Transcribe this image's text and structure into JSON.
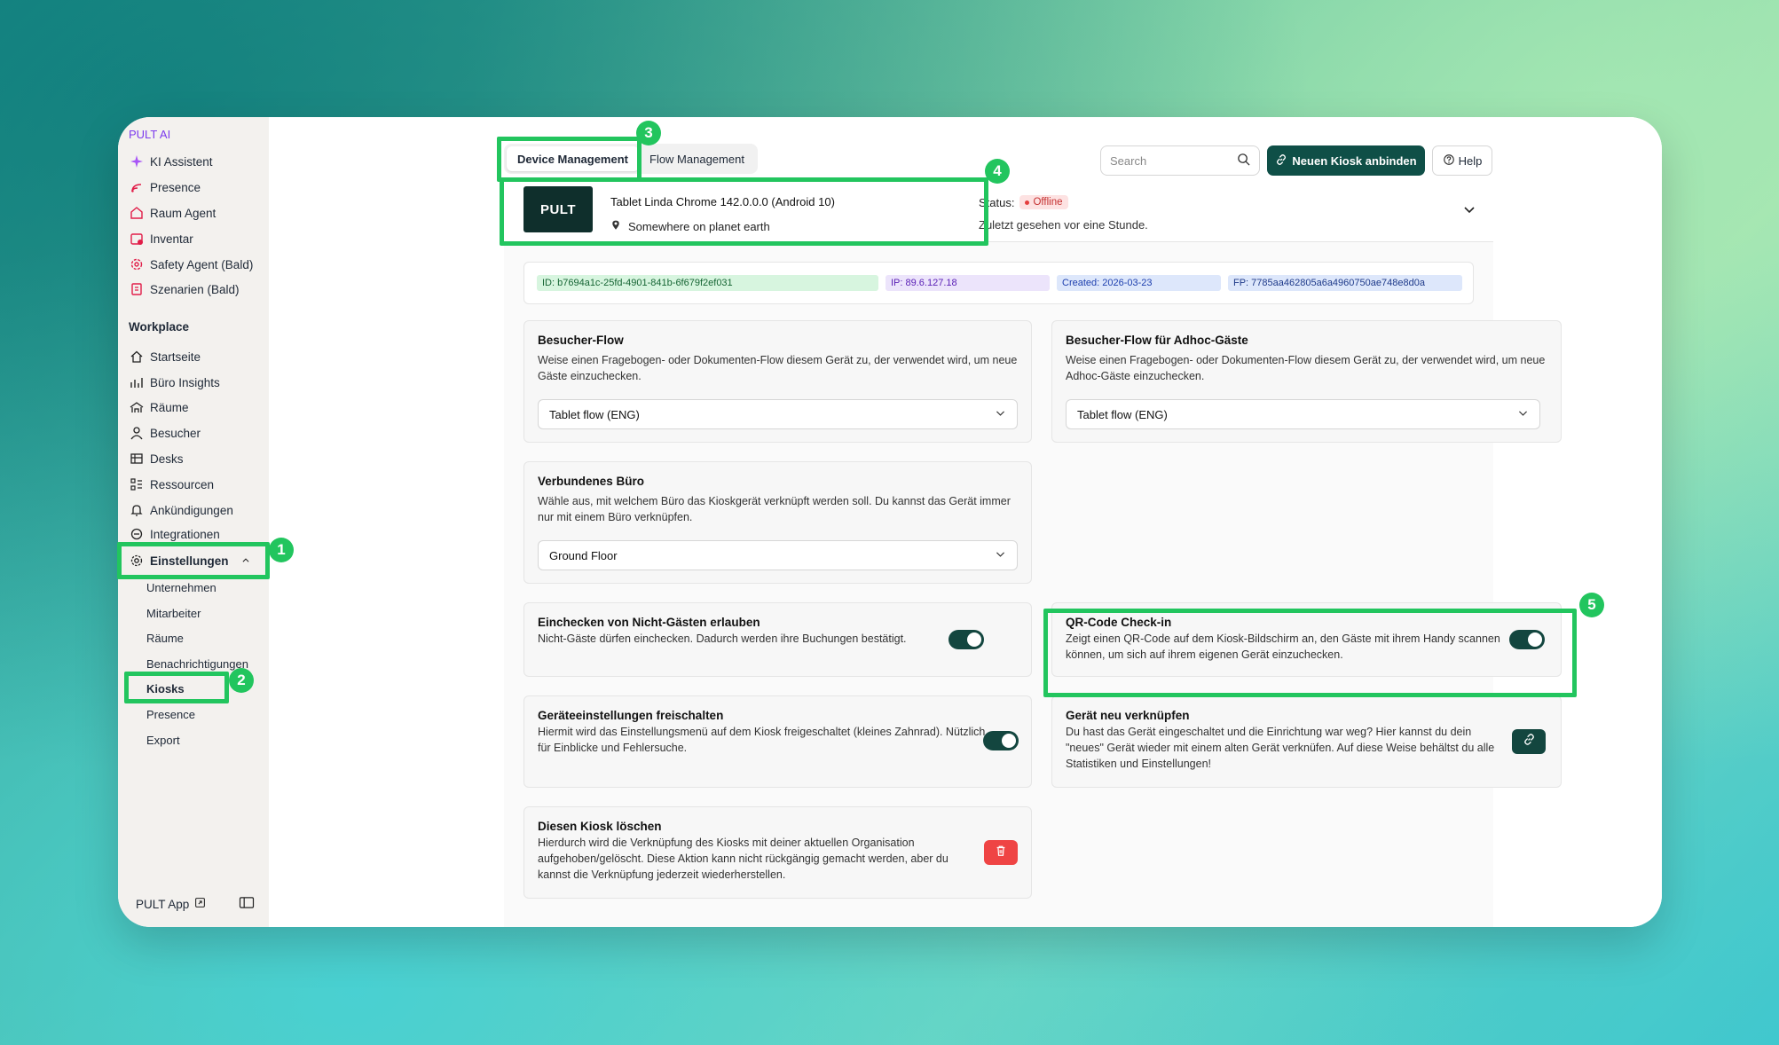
{
  "sidebar": {
    "brand": "PULT AI",
    "ai_items": [
      {
        "label": "KI Assistent",
        "icon": "sparkle-icon"
      },
      {
        "label": "Presence",
        "icon": "presence-icon"
      },
      {
        "label": "Raum Agent",
        "icon": "room-agent-icon"
      },
      {
        "label": "Inventar",
        "icon": "inventory-icon"
      },
      {
        "label": "Safety Agent (Bald)",
        "icon": "safety-icon"
      },
      {
        "label": "Szenarien (Bald)",
        "icon": "scenario-icon"
      }
    ],
    "section_label": "Workplace",
    "workplace_items": [
      {
        "label": "Startseite",
        "icon": "home-icon"
      },
      {
        "label": "Büro Insights",
        "icon": "chart-icon"
      },
      {
        "label": "Räume",
        "icon": "rooms-icon"
      },
      {
        "label": "Besucher",
        "icon": "user-icon"
      },
      {
        "label": "Desks",
        "icon": "desk-icon"
      },
      {
        "label": "Ressourcen",
        "icon": "resources-icon"
      },
      {
        "label": "Ankündigungen",
        "icon": "bell-icon"
      },
      {
        "label": "Integrationen",
        "icon": "integration-icon"
      }
    ],
    "settings_label": "Einstellungen",
    "settings_items": [
      {
        "label": "Unternehmen"
      },
      {
        "label": "Mitarbeiter"
      },
      {
        "label": "Räume"
      },
      {
        "label": "Benachrichtigungen"
      },
      {
        "label": "Kiosks"
      },
      {
        "label": "Presence"
      },
      {
        "label": "Export"
      }
    ],
    "footer_app": "PULT App"
  },
  "header": {
    "tabs": [
      {
        "label": "Device Management",
        "active": true
      },
      {
        "label": "Flow Management",
        "active": false
      }
    ],
    "search_placeholder": "Search",
    "connect_button": "Neuen Kiosk anbinden",
    "help_button": "Help"
  },
  "device": {
    "logo_text": "PULT",
    "name": "Tablet Linda Chrome 142.0.0.0 (Android 10)",
    "location": "Somewhere on planet earth",
    "status_label": "Status:",
    "status_value": "Offline",
    "last_seen": "Zuletzt gesehen vor eine Stunde."
  },
  "ids": {
    "id": "ID: b7694a1c-25fd-4901-841b-6f679f2ef031",
    "ip": "IP: 89.6.127.18",
    "created": "Created: 2026-03-23",
    "fp": "FP: 7785aa462805a6a4960750ae748e8d0a"
  },
  "cards": {
    "visitor_flow": {
      "title": "Besucher-Flow",
      "desc": "Weise einen Fragebogen- oder Dokumenten-Flow diesem Gerät zu, der verwendet wird, um neue Gäste einzuchecken.",
      "value": "Tablet flow (ENG)"
    },
    "adhoc_flow": {
      "title": "Besucher-Flow für Adhoc-Gäste",
      "desc": "Weise einen Fragebogen- oder Dokumenten-Flow diesem Gerät zu, der verwendet wird, um neue Adhoc-Gäste einzuchecken.",
      "value": "Tablet flow (ENG)"
    },
    "office": {
      "title": "Verbundenes Büro",
      "desc": "Wähle aus, mit welchem Büro das Kioskgerät verknüpft werden soll. Du kannst das Gerät immer nur mit einem Büro verknüpfen.",
      "value": "Ground Floor"
    },
    "non_guest": {
      "title": "Einchecken von Nicht-Gästen erlauben",
      "desc": "Nicht-Gäste dürfen einchecken. Dadurch werden ihre Buchungen bestätigt."
    },
    "qr": {
      "title": "QR-Code Check-in",
      "desc": "Zeigt einen QR-Code auf dem Kiosk-Bildschirm an, den Gäste mit ihrem Handy scannen können, um sich auf ihrem eigenen Gerät einzuchecken."
    },
    "device_settings": {
      "title": "Geräteeinstellungen freischalten",
      "desc": "Hiermit wird das Einstellungsmenü auf dem Kiosk freigeschaltet (kleines Zahnrad). Nützlich für Einblicke und Fehlersuche."
    },
    "relink": {
      "title": "Gerät neu verknüpfen",
      "desc": "Du hast das Gerät eingeschaltet und die Einrichtung war weg? Hier kannst du dein \"neues\" Gerät wieder mit einem alten Gerät verknüfen. Auf diese Weise behältst du alle Statistiken und Einstellungen!"
    },
    "delete": {
      "title": "Diesen Kiosk löschen",
      "desc": "Hierdurch wird die Verknüpfung des Kiosks mit deiner aktuellen Organisation aufgehoben/gelöscht. Diese Aktion kann nicht rückgängig gemacht werden, aber du kannst die Verknüpfung jederzeit wiederherstellen."
    }
  },
  "annotations": [
    "1",
    "2",
    "3",
    "4",
    "5"
  ],
  "colors": {
    "accent": "#0f4f47",
    "highlight": "#22c55e",
    "danger": "#ef4444",
    "brand": "#7c3aed"
  }
}
